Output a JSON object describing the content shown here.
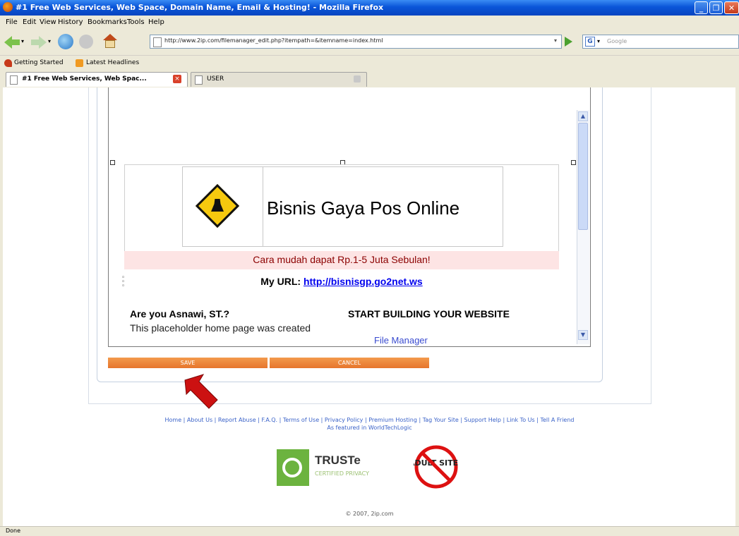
{
  "window": {
    "title": "#1 Free Web Services, Web Space, Domain Name, Email & Hosting! - Mozilla Firefox"
  },
  "menu": {
    "file": "File",
    "edit": "Edit",
    "view": "View",
    "history": "History",
    "bookmarks": "Bookmarks",
    "tools": "Tools",
    "help": "Help"
  },
  "nav": {
    "url": "http://www.2ip.com/filemanager_edit.php?itempath=&itemname=index.html",
    "search_placeholder": "Google"
  },
  "bookmarks": {
    "items": [
      "Getting Started",
      "Latest Headlines"
    ]
  },
  "tabs": [
    "#1 Free Web Services, Web Spac...",
    "USER"
  ],
  "editor": {
    "site_title": "Bisnis Gaya Pos Online",
    "tagline": "Cara mudah dapat Rp.1-5 Juta Sebulan!",
    "url_label": "My URL:",
    "url_link": "http://bisnisgp.go2net.ws",
    "question": "Are you Asnawi, ST.?",
    "body_text": "This placeholder home page was created",
    "start_heading": "START BUILDING YOUR WEBSITE",
    "file_manager_link": "File Manager"
  },
  "buttons": {
    "save": "SAVE",
    "cancel": "CANCEL"
  },
  "footer": {
    "links": "Home | About Us | Report Abuse | F.A.Q. | Terms of Use | Privacy Policy | Premium Hosting | Tag Your Site | Support Help | Link To Us | Tell A Friend",
    "featured": "As featured in WorldTechLogic",
    "truste_title": "TRUSTe",
    "truste_sub": "CERTIFIED PRIVACY",
    "adult_text": "ADULT SITES",
    "copyright": "© 2007, 2ip.com"
  },
  "status": "Done",
  "colors": {
    "accent_orange": "#e6752c",
    "title_blue": "#0a55d8",
    "tagline_red": "#8b0000",
    "arrow_red": "#cc1111"
  }
}
